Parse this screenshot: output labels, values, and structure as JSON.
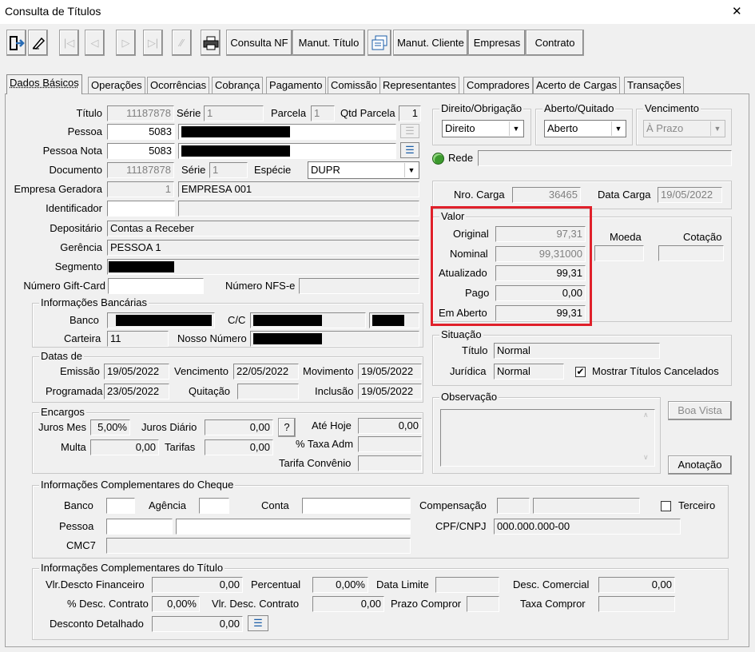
{
  "window": {
    "title": "Consulta de Títulos",
    "close": "✕"
  },
  "toolbar": {
    "consulta_nf": "Consulta NF",
    "manut_titulo": "Manut. Título",
    "manut_cliente": "Manut. Cliente",
    "empresas": "Empresas",
    "contrato": "Contrato"
  },
  "tabs": [
    "Dados Básicos",
    "Operações",
    "Ocorrências",
    "Cobrança",
    "Pagamento",
    "Comissão",
    "Representantes",
    "Compradores",
    "Acerto de Cargas",
    "Transações"
  ],
  "basic": {
    "titulo_label": "Título",
    "titulo": "11187878",
    "serie_label": "Série",
    "serie": "1",
    "parcela_label": "Parcela",
    "parcela": "1",
    "qtd_parcela_label": "Qtd Parcela",
    "qtd_parcela": "1",
    "pessoa_label": "Pessoa",
    "pessoa": "5083",
    "pessoa_nota_label": "Pessoa Nota",
    "pessoa_nota": "5083",
    "documento_label": "Documento",
    "documento": "11187878",
    "serie2_label": "Série",
    "serie2": "1",
    "especie_label": "Espécie",
    "especie": "DUPR",
    "empresa_label": "Empresa Geradora",
    "empresa_code": "1",
    "empresa_name": "EMPRESA 001",
    "identificador_label": "Identificador",
    "depositario_label": "Depositário",
    "depositario": "Contas a Receber",
    "gerencia_label": "Gerência",
    "gerencia": "PESSOA 1",
    "segmento_label": "Segmento",
    "giftcard_label": "Número Gift-Card",
    "nfse_label": "Número NFS-e"
  },
  "bank": {
    "title": "Informações Bancárias",
    "banco_label": "Banco",
    "cc_label": "C/C",
    "carteira_label": "Carteira",
    "carteira": "11",
    "nosso_label": "Nosso Número"
  },
  "dates": {
    "title": "Datas de",
    "emissao_label": "Emissão",
    "emissao": "19/05/2022",
    "venc_label": "Vencimento",
    "venc": "22/05/2022",
    "mov_label": "Movimento",
    "mov": "19/05/2022",
    "prog_label": "Programada",
    "prog": "23/05/2022",
    "quit_label": "Quitação",
    "incl_label": "Inclusão",
    "incl": "19/05/2022"
  },
  "enc": {
    "title": "Encargos",
    "juros_mes_label": "Juros Mes",
    "juros_mes": "5,00%",
    "juros_diario_label": "Juros Diário",
    "juros_diario": "0,00",
    "help": "?",
    "ate_hoje_label": "Até Hoje",
    "ate_hoje": "0,00",
    "multa_label": "Multa",
    "multa": "0,00",
    "tarifas_label": "Tarifas",
    "tarifas": "0,00",
    "taxa_adm_label": "% Taxa Adm",
    "tarifa_conv_label": "Tarifa Convênio"
  },
  "right": {
    "direito_title": "Direito/Obrigação",
    "direito": "Direito",
    "aberto_title": "Aberto/Quitado",
    "aberto": "Aberto",
    "venc_title": "Vencimento",
    "venc": "À Prazo",
    "rede_label": "Rede",
    "nro_carga_label": "Nro. Carga",
    "nro_carga": "36465",
    "data_carga_label": "Data Carga",
    "data_carga": "19/05/2022"
  },
  "valor": {
    "title": "Valor",
    "original_label": "Original",
    "original": "97,31",
    "nominal_label": "Nominal",
    "nominal": "99,31000",
    "atualizado_label": "Atualizado",
    "atualizado": "99,31",
    "pago_label": "Pago",
    "pago": "0,00",
    "aberto_label": "Em Aberto",
    "aberto": "99,31",
    "moeda_label": "Moeda",
    "cotacao_label": "Cotação"
  },
  "situacao": {
    "title": "Situação",
    "titulo_label": "Título",
    "titulo": "Normal",
    "juridica_label": "Jurídica",
    "juridica": "Normal",
    "mostrar_label": "Mostrar Títulos Cancelados",
    "mostrar_checked": "✔"
  },
  "obs": {
    "title": "Observação",
    "boa_vista": "Boa Vista",
    "anotacao": "Anotação"
  },
  "cheque": {
    "title": "Informações Complementares do Cheque",
    "banco_label": "Banco",
    "agencia_label": "Agência",
    "conta_label": "Conta",
    "comp_label": "Compensação",
    "terceiro_label": "Terceiro",
    "pessoa_label": "Pessoa",
    "cpf_label": "CPF/CNPJ",
    "cpf": "000.000.000-00",
    "cmc7_label": "CMC7"
  },
  "comp": {
    "title": "Informações Complementares do Título",
    "vlr_desc_fin_label": "Vlr.Descto Financeiro",
    "vlr_desc_fin": "0,00",
    "percentual_label": "Percentual",
    "percentual": "0,00%",
    "data_limite_label": "Data Limite",
    "desc_com_label": "Desc. Comercial",
    "desc_com": "0,00",
    "pct_desc_contrato_label": "% Desc. Contrato",
    "pct_desc_contrato": "0,00%",
    "vlr_desc_contrato_label": "Vlr. Desc. Contrato",
    "vlr_desc_contrato": "0,00",
    "prazo_label": "Prazo Compror",
    "taxa_label": "Taxa Compror",
    "desc_det_label": "Desconto Detalhado",
    "desc_det": "0,00"
  },
  "colors": {
    "highlight": "#e0202a",
    "bg": "#f0f0f0",
    "green": "#3c9a2e"
  }
}
